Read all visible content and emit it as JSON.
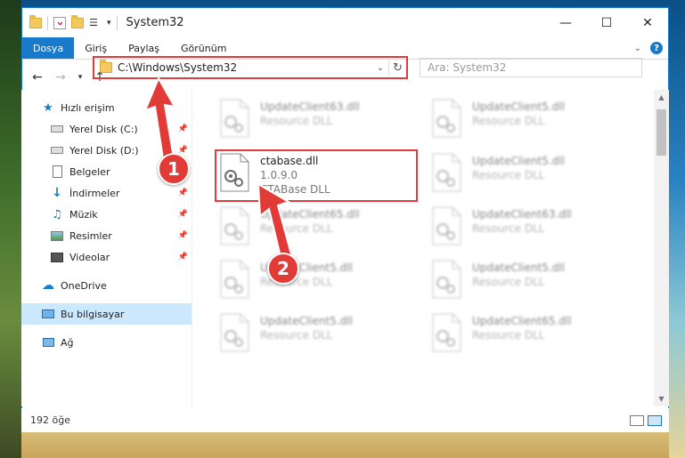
{
  "window": {
    "title": "System32",
    "controls": {
      "minimize": "—",
      "maximize": "☐",
      "close": "✕"
    }
  },
  "ribbon": {
    "tabs": [
      "Dosya",
      "Giriş",
      "Paylaş",
      "Görünüm"
    ],
    "active_tab": "Dosya"
  },
  "address": {
    "path": "C:\\Windows\\System32",
    "search_placeholder": "Ara: System32"
  },
  "nav": {
    "quick_access": "Hızlı erişim",
    "items": [
      {
        "label": "Yerel Disk (C:)",
        "icon": "drive-icon",
        "pinned": true
      },
      {
        "label": "Yerel Disk (D:)",
        "icon": "drive-icon",
        "pinned": true
      },
      {
        "label": "Belgeler",
        "icon": "documents-icon",
        "pinned": true
      },
      {
        "label": "İndirmeler",
        "icon": "download-icon",
        "pinned": true
      },
      {
        "label": "Müzik",
        "icon": "music-icon",
        "pinned": true
      },
      {
        "label": "Resimler",
        "icon": "pictures-icon",
        "pinned": true
      },
      {
        "label": "Videolar",
        "icon": "videos-icon",
        "pinned": true
      }
    ],
    "onedrive": "OneDrive",
    "this_pc": "Bu bilgisayar",
    "network": "Ağ"
  },
  "files": [
    {
      "name": "UpdateClient63.dll",
      "desc": "Resource DLL"
    },
    {
      "name": "UpdateClient5.dll",
      "desc": "Resource DLL"
    },
    {
      "name": "ctabase.dll",
      "version": "1.0.9.0",
      "desc": "CTABase DLL"
    },
    {
      "name": "UpdateClient5.dll",
      "desc": "Resource DLL"
    },
    {
      "name": "UpdateClient65.dll",
      "desc": "Resource DLL"
    },
    {
      "name": "UpdateClient63.dll",
      "desc": "Resource DLL"
    },
    {
      "name": "UpdateClient5.dll",
      "desc": "Resource DLL"
    },
    {
      "name": "UpdateClient5.dll",
      "desc": "Resource DLL"
    },
    {
      "name": "UpdateClient5.dll",
      "desc": "Resource DLL"
    },
    {
      "name": "UpdateClient65.dll",
      "desc": "Resource DLL"
    }
  ],
  "status": {
    "count": "192 öğe"
  },
  "callouts": {
    "one": "1",
    "two": "2"
  },
  "colors": {
    "accent": "#1979ca",
    "highlight": "#e03c3c"
  }
}
